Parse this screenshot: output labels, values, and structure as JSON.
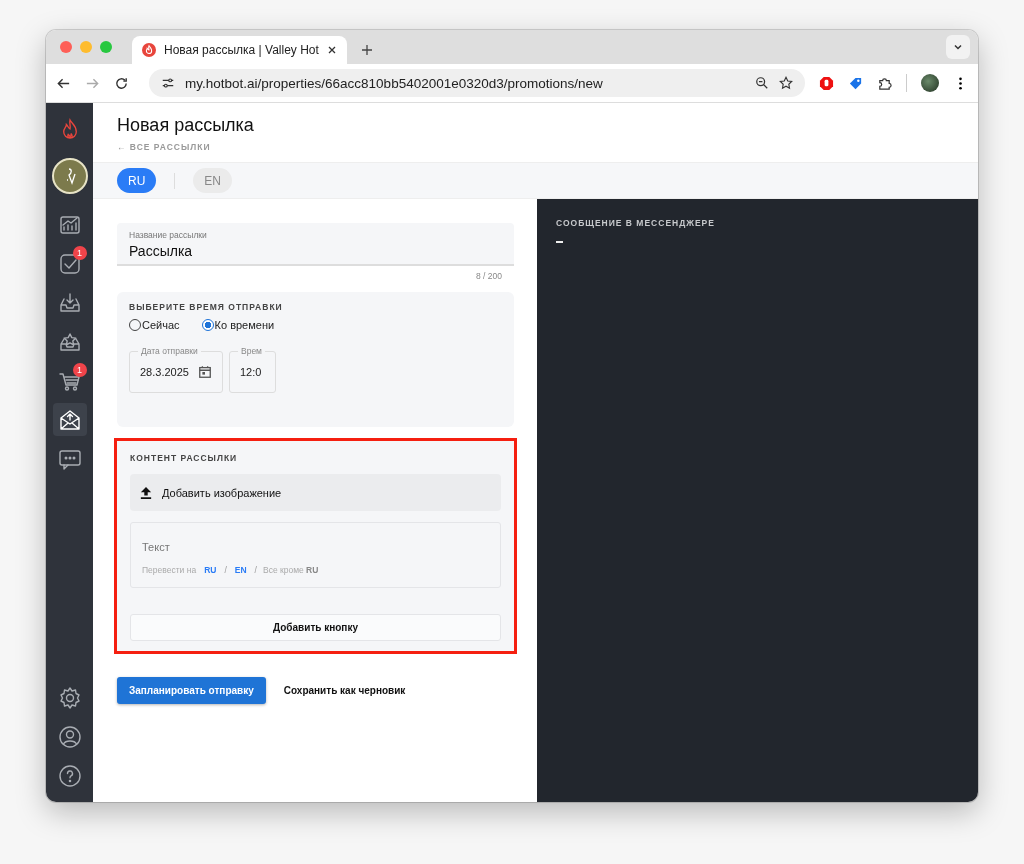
{
  "browser": {
    "tab_title": "Новая рассылка | Valley Hot",
    "url": "my.hotbot.ai/properties/66acc810bb5402001e0320d3/promotions/new"
  },
  "sidebar": {
    "items": [
      {
        "kind": "chart",
        "selected": false
      },
      {
        "kind": "task",
        "selected": false,
        "badge": "1"
      },
      {
        "kind": "inbox",
        "selected": false
      },
      {
        "kind": "star",
        "selected": false
      },
      {
        "kind": "cart",
        "selected": false,
        "badge": "1"
      },
      {
        "kind": "mail",
        "selected": true
      },
      {
        "kind": "chat",
        "selected": false
      }
    ],
    "bottom_items": [
      {
        "kind": "settings"
      },
      {
        "kind": "user"
      },
      {
        "kind": "help"
      }
    ]
  },
  "header": {
    "title": "Новая рассылка",
    "back_link": "← ВСЕ РАССЫЛКИ"
  },
  "lang_tabs": [
    {
      "label": "RU",
      "selected": true
    },
    {
      "label": "EN",
      "selected": false
    }
  ],
  "name_field": {
    "label": "Название рассылки",
    "value": "Рассылка",
    "counter": "8 / 200"
  },
  "time_section": {
    "title": "ВЫБЕРИТЕ ВРЕМЯ ОТПРАВКИ",
    "options": [
      {
        "label": "Сейчас",
        "selected": false
      },
      {
        "label": "Ко времени",
        "selected": true
      }
    ],
    "date_field": {
      "label": "Дата отправки",
      "value": "28.3.2025"
    },
    "time_field": {
      "label": "Врем",
      "value": "12:0"
    }
  },
  "content_section": {
    "title": "КОНТЕНТ РАССЫЛКИ",
    "highlighted": true,
    "image_button": "Добавить изображение",
    "text_placeholder": "Текст",
    "translate": [
      {
        "kind": "label",
        "text": "Перевести на"
      },
      {
        "kind": "link",
        "text": "RU"
      },
      {
        "kind": "sep",
        "text": "/"
      },
      {
        "kind": "link",
        "text": "EN"
      },
      {
        "kind": "sep",
        "text": "/"
      },
      {
        "kind": "label",
        "text": "Все кроме **RU**"
      }
    ],
    "add_button": "Добавить кнопку"
  },
  "actions": {
    "primary": "Запланировать отправку",
    "secondary": "Сохранить как черновик"
  },
  "preview": {
    "title": "СООБЩЕНИЕ В МЕССЕНДЖЕРЕ"
  }
}
